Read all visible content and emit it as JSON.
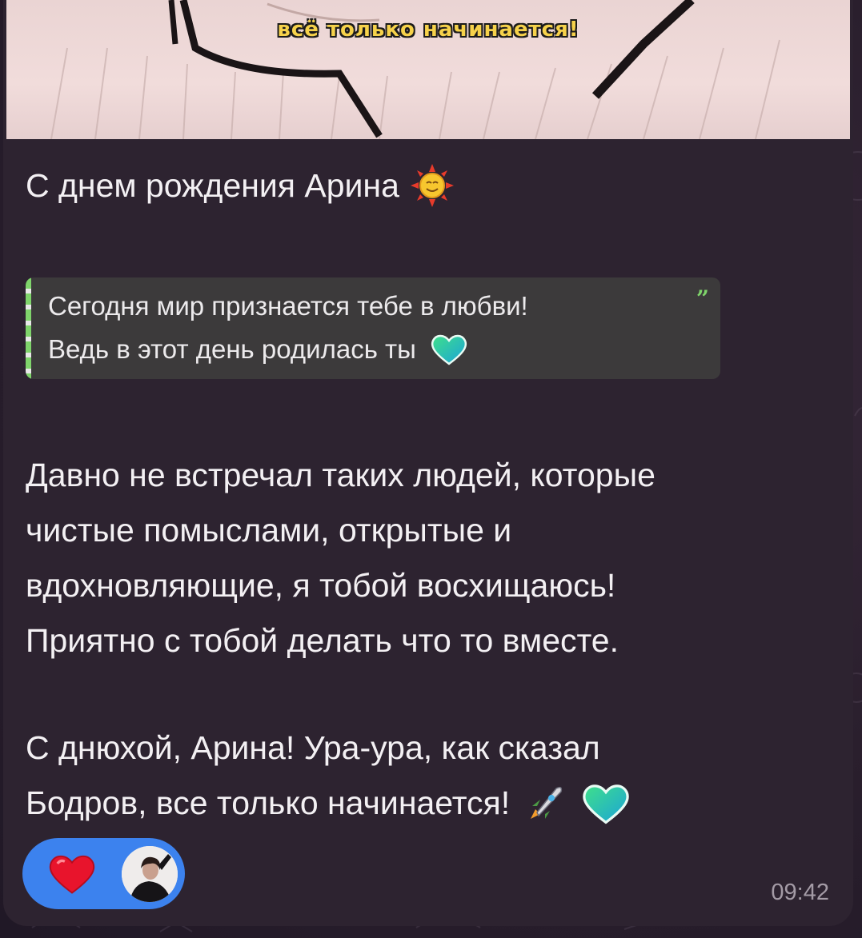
{
  "video": {
    "caption": "всё только начинается!"
  },
  "message": {
    "heading": "С днем рождения Арина",
    "heading_emoji": "sun-face-icon",
    "quote": {
      "line1": "Сегодня мир признается тебе в любви!",
      "line2": "Ведь в этот день родилась ты",
      "line2_emoji": "gradient-heart-icon",
      "quote_icon": "quote-mark-icon"
    },
    "paragraph1": [
      "Давно не встречал таких людей, которые",
      "чистые помыслами, открытые и",
      "вдохновляющие, я тобой восхищаюсь!",
      "Приятно с тобой делать что то вместе."
    ],
    "paragraph2": [
      "С днюхой, Арина! Ура-ура, как сказал",
      "Бодров, все только начинается!"
    ],
    "paragraph2_emojis": [
      "rocket-icon",
      "gradient-heart-icon"
    ],
    "time": "09:42"
  },
  "reactions": {
    "emoji": "red-heart-icon",
    "reactor": "avatar"
  },
  "colors": {
    "bubble": "#2d2330",
    "accent_green": "#7fd46b",
    "reaction_blue": "#3c82ee",
    "text": "#f3f0f3"
  }
}
